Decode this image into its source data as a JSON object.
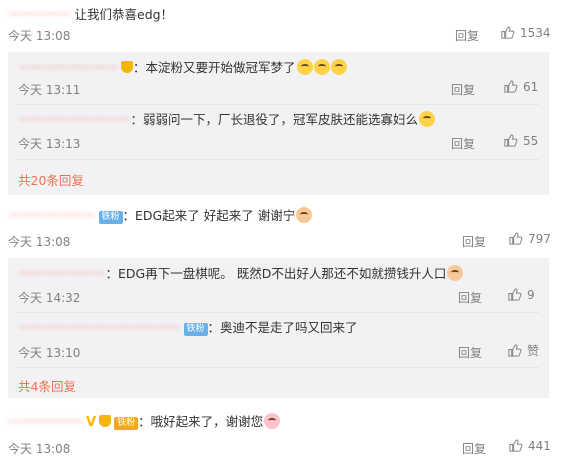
{
  "comments": [
    {
      "user": "一一一一一",
      "text": "让我们恭喜edg！",
      "time": "今天 13:08",
      "reply_label": "回复",
      "likes": "1534",
      "replies": [
        {
          "user": "一一一一一一一一",
          "text": "：本淀粉又要开始做冠军梦了",
          "time": "今天 13:11",
          "reply_label": "回复",
          "likes": "61"
        },
        {
          "user": "一一一一一一一一一",
          "text": "：弱弱问一下，厂长退役了，冠军皮肤还能选寡妇么",
          "time": "今天 13:13",
          "reply_label": "回复",
          "likes": "55"
        }
      ],
      "more_replies": "共20条回复"
    },
    {
      "user": "一一一一一一一",
      "badge": "铁粉",
      "text": "：EDG起来了 好起来了 谢谢宁",
      "time": "今天 13:08",
      "reply_label": "回复",
      "likes": "797",
      "replies": [
        {
          "user": "一一一一一一一",
          "text": "：EDG再下一盘棋呢。 既然D不出好人那还不如就攒钱升人口",
          "time": "今天 14:32",
          "reply_label": "回复",
          "likes": "9"
        },
        {
          "user": "一一一一一一一一一一一一一",
          "badge": "铁粉",
          "text": "：奥迪不是走了吗又回来了",
          "time": "今天 13:10",
          "reply_label": "回复",
          "likes": "赞"
        }
      ],
      "more_replies": "共4条回复"
    },
    {
      "user": "一一一一一一",
      "badge": "铁粉",
      "text": "：哦好起来了，谢谢您",
      "time": "今天 13:08",
      "reply_label": "回复",
      "likes": "441"
    }
  ]
}
